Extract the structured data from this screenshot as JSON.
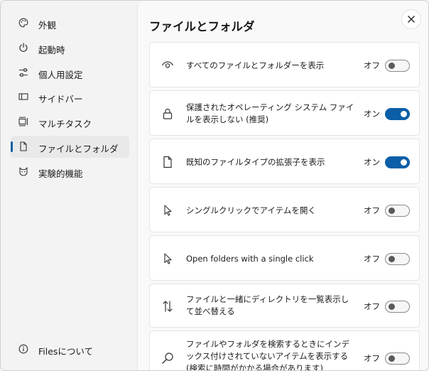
{
  "sidebar": {
    "items": [
      {
        "label": "外観",
        "icon": "palette-icon"
      },
      {
        "label": "起動時",
        "icon": "power-icon"
      },
      {
        "label": "個人用設定",
        "icon": "sliders-icon"
      },
      {
        "label": "サイドバー",
        "icon": "sidebar-icon"
      },
      {
        "label": "マルチタスク",
        "icon": "multitask-icon"
      },
      {
        "label": "ファイルとフォルダ",
        "icon": "document-icon",
        "selected": true
      },
      {
        "label": "実験的機能",
        "icon": "cat-icon"
      }
    ],
    "about": {
      "label": "Filesについて",
      "icon": "info-icon"
    }
  },
  "page": {
    "title": "ファイルとフォルダ"
  },
  "colors": {
    "accent": "#0a5fa8",
    "background": "#f3f3f3",
    "card": "#ffffff"
  },
  "settings": [
    {
      "icon": "eye-icon",
      "text": "すべてのファイルとフォルダーを表示",
      "state": "オフ",
      "on": false
    },
    {
      "icon": "lock-icon",
      "text": "保護されたオペレーティング システム ファイルを表示しない (推奨)",
      "state": "オン",
      "on": true
    },
    {
      "icon": "file-icon",
      "text": "既知のファイルタイプの拡張子を表示",
      "state": "オン",
      "on": true
    },
    {
      "icon": "cursor-icon",
      "text": "シングルクリックでアイテムを開く",
      "state": "オフ",
      "on": false
    },
    {
      "icon": "cursor-icon",
      "text": "Open folders with a single click",
      "state": "オフ",
      "on": false
    },
    {
      "icon": "sort-arrows-icon",
      "text": "ファイルと一緒にディレクトリを一覧表示して並べ替える",
      "state": "オフ",
      "on": false
    },
    {
      "icon": "search-icon",
      "text": "ファイルやフォルダを検索するときにインデックス付けされていないアイテムを表示する (検索に時間がかかる場合があります)",
      "state": "オフ",
      "on": false
    }
  ]
}
